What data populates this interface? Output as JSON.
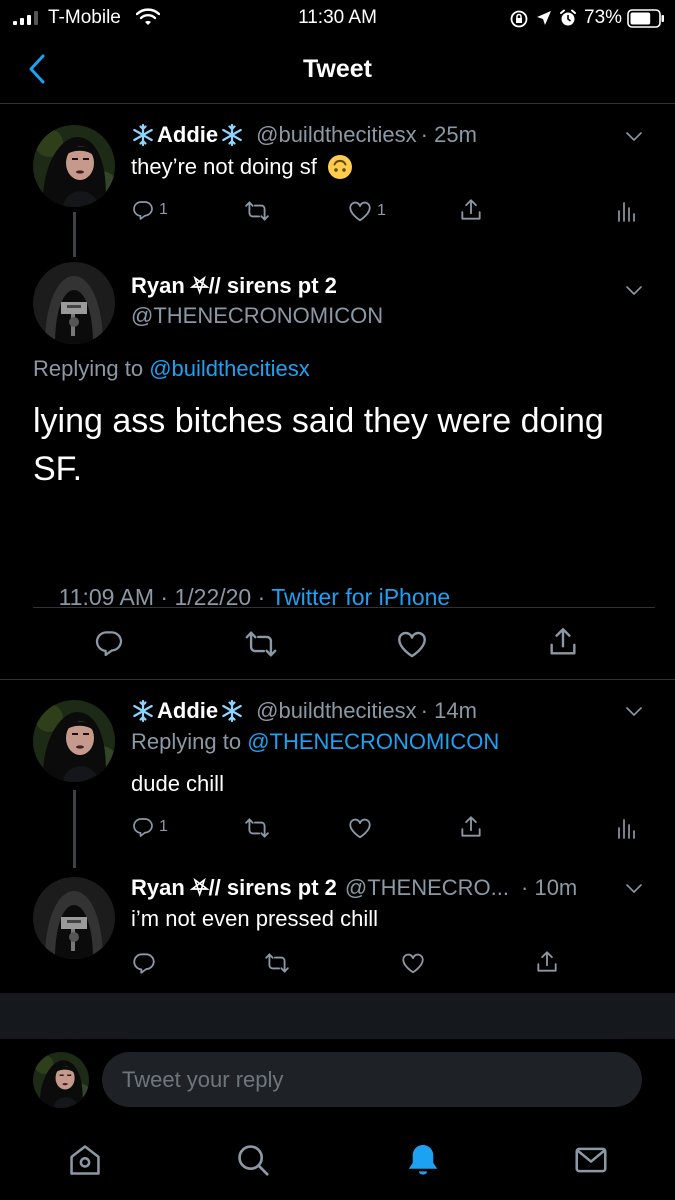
{
  "status_bar": {
    "carrier": "T-Mobile",
    "time": "11:30 AM",
    "battery_percent": "73%",
    "battery_level": 0.73
  },
  "header": {
    "title": "Tweet"
  },
  "tweets": {
    "parent": {
      "name": "Addie",
      "handle": "@buildthecitiesx",
      "time": "· 25m",
      "text": "they’re not doing sf",
      "reply_count": "1",
      "like_count": "1"
    },
    "main": {
      "name": "Ryan ⛧// sirens pt 2",
      "handle": "@THENECRONOMICON",
      "replying_prefix": "Replying to",
      "replying_to": "@buildthecitiesx",
      "text_line1": "lying ass bitches said they were doing",
      "text_line2": "SF.",
      "timestamp": "11:09 AM · 1/22/20 · ",
      "source": "Twitter for iPhone"
    },
    "reply1": {
      "name": "Addie",
      "handle": "@buildthecitiesx",
      "time": "· 14m",
      "replying_prefix": "Replying to",
      "replying_to": "@THENECRONOMICON",
      "text": "dude chill",
      "reply_count": "1"
    },
    "reply2": {
      "name": "Ryan ⛧// sirens pt 2",
      "handle": "@THENECRO...",
      "time": "· 10m",
      "text": "i’m not even pressed chill"
    }
  },
  "composer": {
    "placeholder": "Tweet your reply"
  },
  "tab_bar": {
    "items": [
      "home-icon",
      "search-icon",
      "notifications-icon",
      "messages-icon"
    ],
    "active": "notifications-icon"
  },
  "colors": {
    "accent": "#1da1f2",
    "secondary_text": "#8b98a5",
    "background": "#000000",
    "divider": "#2f3336"
  }
}
